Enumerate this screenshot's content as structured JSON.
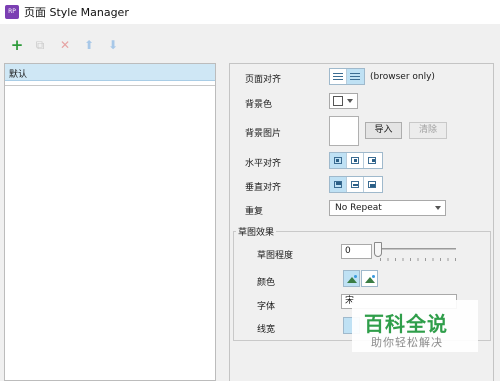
{
  "window": {
    "title": "页面 Style Manager",
    "app_icon": "rp-app-icon"
  },
  "toolbar": {
    "add": "+",
    "copy": "⧉",
    "delete": "✕",
    "up": "⬆",
    "down": "⬇"
  },
  "style_list": {
    "items": [
      {
        "label": "默认",
        "selected": true
      }
    ]
  },
  "properties": {
    "page_align": {
      "label": "页面对齐",
      "note": "(browser only)",
      "options": [
        "left",
        "center"
      ],
      "selected": "center"
    },
    "bg_color": {
      "label": "背景色",
      "value": "#ffffff"
    },
    "bg_image": {
      "label": "背景图片",
      "import_label": "导入",
      "clear_label": "清除"
    },
    "h_align": {
      "label": "水平对齐",
      "options": [
        "left",
        "center",
        "right"
      ],
      "selected": "left"
    },
    "v_align": {
      "label": "垂直对齐",
      "options": [
        "top",
        "middle",
        "bottom"
      ],
      "selected": "top"
    },
    "repeat": {
      "label": "重复",
      "value": "No Repeat"
    }
  },
  "sketch": {
    "group_label": "草图效果",
    "level_label": "草图程度",
    "level_value": "0",
    "color_label": "颜色",
    "font_label": "字体",
    "font_value": "宋",
    "line_width_label": "线宽"
  },
  "watermark": {
    "main": "百科全说",
    "sub": "助你轻松解决"
  },
  "colors": {
    "accent": "#bfe1f4",
    "selected_row": "#cfe7f5",
    "watermark_green": "#2f9e4a"
  }
}
